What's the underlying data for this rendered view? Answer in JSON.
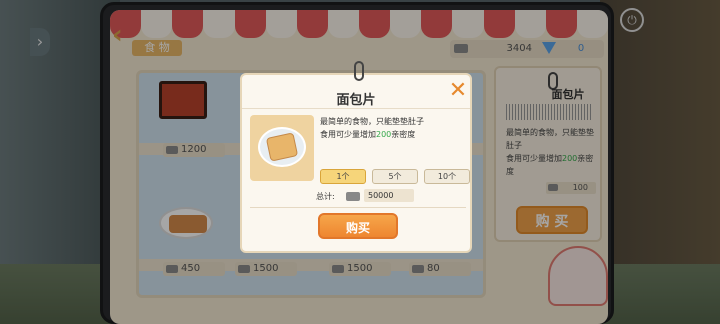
{
  "header": {
    "category_tab": "食 物",
    "cash": "3404",
    "gems": "0"
  },
  "shelf": {
    "prices": [
      "1200",
      "450",
      "1500",
      "1500",
      "80"
    ]
  },
  "side_panel": {
    "title": "面包片",
    "desc_prefix": "最简单的食物，只能垫垫肚子",
    "desc_line2_prefix": "食用可少量增加",
    "desc_highlight": "200",
    "desc_line2_suffix": "亲密度",
    "price": "100",
    "buy_label": "购 买"
  },
  "dialog": {
    "title": "面包片",
    "desc_line1": "最简单的食物，只能垫垫肚子",
    "desc_line2_prefix": "食用可少量增加",
    "desc_highlight": "200",
    "desc_line2_suffix": "亲密度",
    "quantities": [
      "1个",
      "5个",
      "10个"
    ],
    "selected_quantity": "1个",
    "total_label": "总计:",
    "total_value": "50000",
    "buy_label": "购买"
  },
  "colors": {
    "accent": "#f0a24a",
    "highlight": "#33a84a",
    "awning_red": "#e05a5a"
  }
}
